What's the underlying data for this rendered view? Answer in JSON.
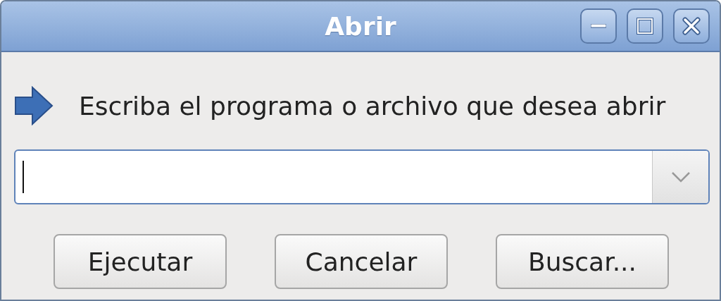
{
  "window": {
    "title": "Abrir"
  },
  "prompt": "Escriba el programa o archivo que desea abrir",
  "command_field": {
    "focused": true
  },
  "buttons": [
    "Ejecutar",
    "Cancelar",
    "Buscar..."
  ]
}
